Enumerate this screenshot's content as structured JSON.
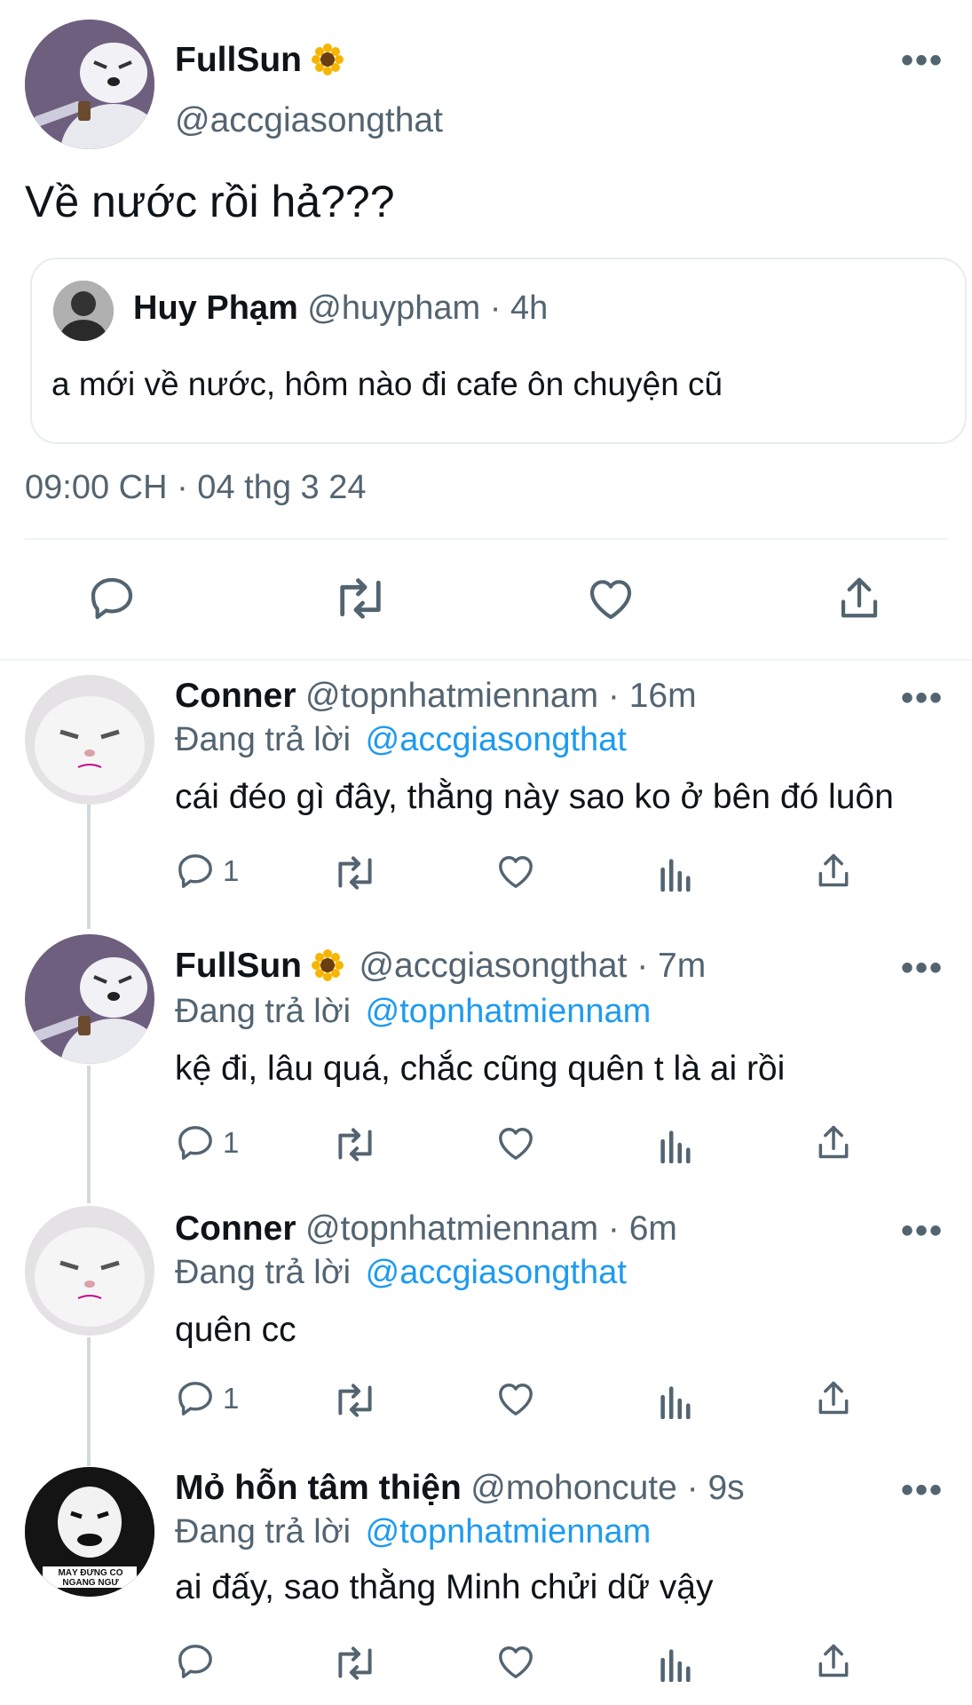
{
  "main_tweet": {
    "name": "FullSun",
    "handle": "@accgiasongthat",
    "text": "Về nước rồi hả???",
    "quote": {
      "name": "Huy Phạm",
      "handle_time": "@huypham · 4h",
      "text": "a mới về nước, hôm nào đi cafe ôn chuyện cũ"
    },
    "timestamp": "09:00 CH · 04 thg 3 24"
  },
  "replies": [
    {
      "name": "Conner",
      "handle_time": "@topnhatmiennam · 16m",
      "replying_prefix": "Đang trả lời",
      "replying_to": "@accgiasongthat",
      "text": "cái đéo gì đây, thằng này sao ko ở bên đó luôn",
      "reply_count": "1"
    },
    {
      "name": "FullSun",
      "handle_time": "@accgiasongthat · 7m",
      "replying_prefix": "Đang trả lời",
      "replying_to": "@topnhatmiennam",
      "text": "kệ đi, lâu quá, chắc cũng quên t là ai rồi",
      "reply_count": "1"
    },
    {
      "name": "Conner",
      "handle_time": "@topnhatmiennam · 6m",
      "replying_prefix": "Đang trả lời",
      "replying_to": "@accgiasongthat",
      "text": "quên cc",
      "reply_count": "1"
    },
    {
      "name": "Mỏ hỗn tâm thiện",
      "handle_time": "@mohoncute · 9s",
      "replying_prefix": "Đang trả lời",
      "replying_to": "@topnhatmiennam",
      "text": "ai đấy, sao thằng Minh chửi dữ vậy",
      "reply_count": "",
      "avatar_caption_1": "MÀY ĐỨNG CÓ",
      "avatar_caption_2": "NGANG NGƯ"
    }
  ],
  "colors": {
    "text": "#0f1419",
    "muted": "#536471",
    "link": "#1d9bf0",
    "divider": "#eff3f4"
  }
}
